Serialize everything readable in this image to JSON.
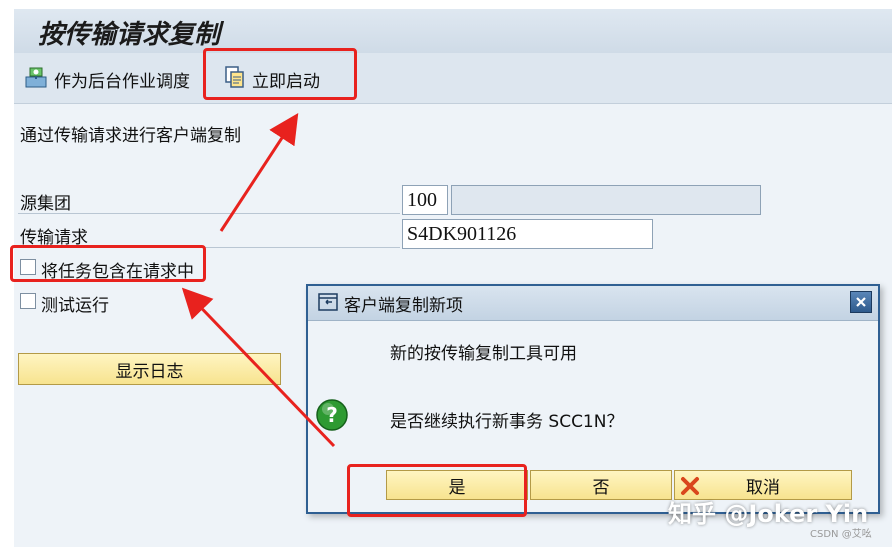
{
  "window": {
    "title": "按传输请求复制"
  },
  "toolbar": {
    "background_job_label": "作为后台作业调度",
    "start_now_label": "立即启动"
  },
  "form": {
    "description": "通过传输请求进行客户端复制",
    "source_client_label": "源集团",
    "source_client_value": "100",
    "transport_request_label": "传输请求",
    "transport_request_value": "S4DK901126",
    "include_tasks_label": "将任务包含在请求中",
    "test_run_label": "测试运行",
    "show_log_label": "显示日志"
  },
  "dialog": {
    "title": "客户端复制新项",
    "message1": "新的按传输复制工具可用",
    "message2": "是否继续执行新事务 SCC1N？",
    "yes_label": "是",
    "no_label": "否",
    "cancel_label": "取消"
  },
  "watermark": {
    "main": "知乎 @Joker Yin",
    "sub": "CSDN @艾吆"
  },
  "colors": {
    "highlight": "#e8221e",
    "button_fill": "#f7e38f",
    "dialog_border": "#2f5f92"
  }
}
